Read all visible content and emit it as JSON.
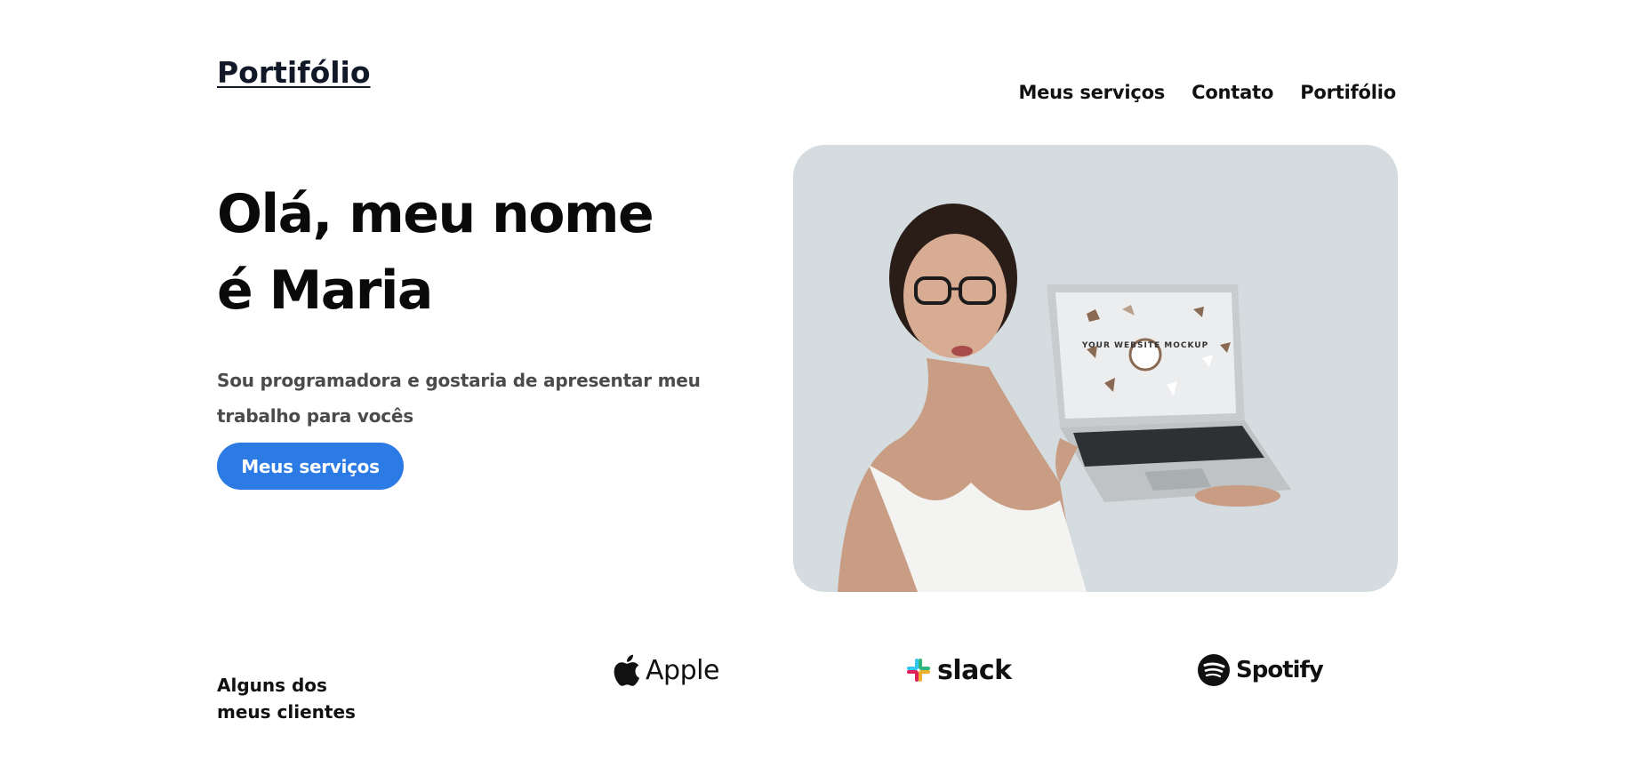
{
  "header": {
    "logo": "Portifólio",
    "nav": [
      "Meus serviços",
      "Contato",
      "Portifólio"
    ]
  },
  "hero": {
    "title_line1": "Olá, meu nome",
    "title_line2": "é Maria",
    "subtitle": "Sou programadora e gostaria de apresentar meu trabalho para vocês",
    "cta_label": "Meus serviços",
    "photo_caption": "YOUR WEBSITE MOCKUP"
  },
  "clients": {
    "title_line1": "Alguns dos",
    "title_line2": "meus clientes",
    "logos": [
      {
        "name": "Apple",
        "icon": "apple-logo-icon"
      },
      {
        "name": "slack",
        "icon": "slack-logo-icon"
      },
      {
        "name": "Spotify",
        "icon": "spotify-logo-icon"
      }
    ]
  },
  "colors": {
    "accent": "#2c7be5",
    "text": "#111111",
    "subtitle": "#4b4b4b",
    "photo_bg": "#d6dde0"
  }
}
